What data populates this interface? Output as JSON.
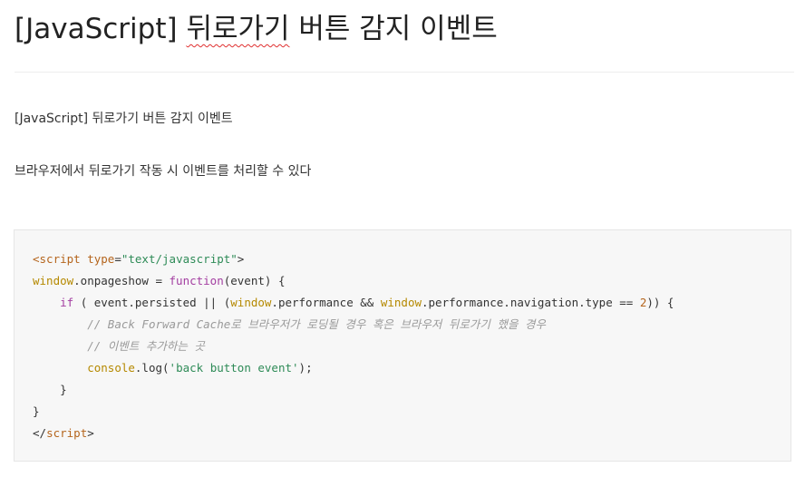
{
  "post": {
    "title_prefix": "[JavaScript] ",
    "title_squiggle": "뒤로가기",
    "title_suffix": " 버튼 감지 이벤트",
    "paragraph_1": "[JavaScript] 뒤로가기 버튼 감지 이벤트",
    "paragraph_2": "브라우저에서 뒤로가기 작동 시 이벤트를 처리할 수 있다"
  },
  "code": {
    "line1": {
      "open": "<",
      "tag": "script",
      "sp": " ",
      "attr": "type",
      "eq": "=",
      "val": "\"text/javascript\"",
      "close": ">"
    },
    "line2": {
      "obj": "window",
      "rest": ".onpageshow = ",
      "kw": "function",
      "tail": "(event) {"
    },
    "line3": {
      "indent": "    ",
      "kw": "if",
      "part1": " ( event.persisted || (",
      "obj1": "window",
      "part2": ".performance && ",
      "obj2": "window",
      "part3": ".performance.navigation.type == ",
      "num": "2",
      "part4": ")) {"
    },
    "line4": {
      "indent": "        ",
      "comment": "// Back Forward Cache로 브라우저가 로딩될 경우 혹은 브라우저 뒤로가기 했을 경우"
    },
    "line5": {
      "indent": "        ",
      "comment": "// 이벤트 추가하는 곳"
    },
    "line6": {
      "indent": "        ",
      "obj": "console",
      "call": ".log(",
      "str": "'back button event'",
      "end": ");"
    },
    "line7": {
      "text": "    }"
    },
    "line8": {
      "text": "}"
    },
    "line9": {
      "open": "</",
      "tag": "script",
      "close": ">"
    }
  }
}
